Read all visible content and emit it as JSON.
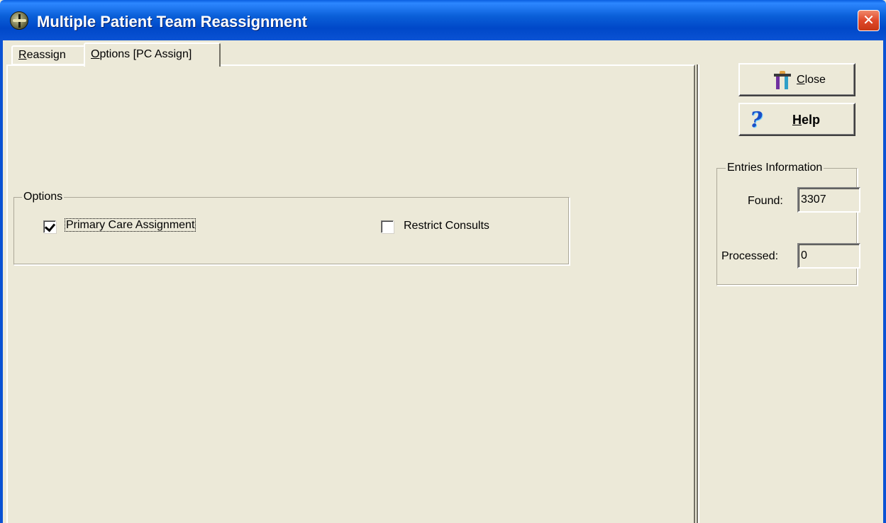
{
  "window": {
    "title": "Multiple Patient Team Reassignment",
    "close_glyph": "✕"
  },
  "tabs": [
    {
      "label_hot": "R",
      "label_rest": "eassign",
      "active": false
    },
    {
      "label_hot": "O",
      "label_rest": "ptions [PC Assign]",
      "active": true
    }
  ],
  "options": {
    "group_label": "Options",
    "primary_care": {
      "label": "Primary Care Assignment",
      "checked": true
    },
    "restrict_consults": {
      "label": "Restrict Consults",
      "checked": false
    }
  },
  "buttons": {
    "close": {
      "hot": "C",
      "rest": "lose",
      "icon": "gate-icon"
    },
    "help": {
      "hot": "H",
      "rest": "elp",
      "icon": "question-mark-icon",
      "glyph": "?"
    }
  },
  "entries": {
    "group_label": "Entries Information",
    "found_label": "Found:",
    "found_value": "3307",
    "processed_label": "Processed:",
    "processed_value": "0"
  }
}
